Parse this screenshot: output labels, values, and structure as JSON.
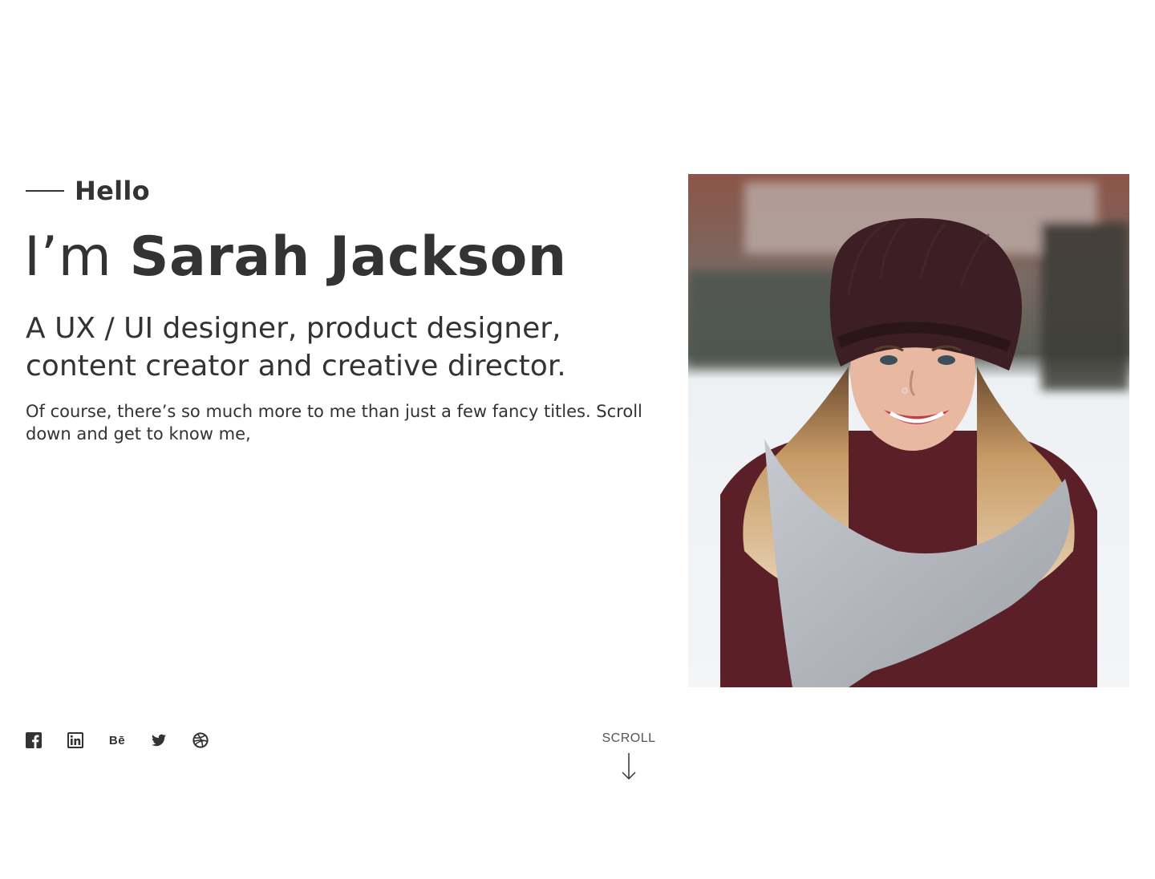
{
  "intro": {
    "greeting": "Hello",
    "name_prefix": "I’m ",
    "name": "Sarah Jackson",
    "tagline": "A UX / UI designer, product designer, content creator and creative director.",
    "description": "Of course, there’s so much more to me than just a few fancy titles. Scroll down and get to know me,"
  },
  "social": [
    {
      "icon": "facebook-icon"
    },
    {
      "icon": "linkedin-icon"
    },
    {
      "icon": "behance-icon",
      "label": "Bē"
    },
    {
      "icon": "twitter-icon"
    },
    {
      "icon": "dribbble-icon"
    }
  ],
  "scroll": {
    "label": "SCROLL",
    "icon": "arrow-down-icon"
  },
  "photo": {
    "subject": "portrait-photo"
  },
  "colors": {
    "text": "#333333",
    "background": "#ffffff"
  }
}
